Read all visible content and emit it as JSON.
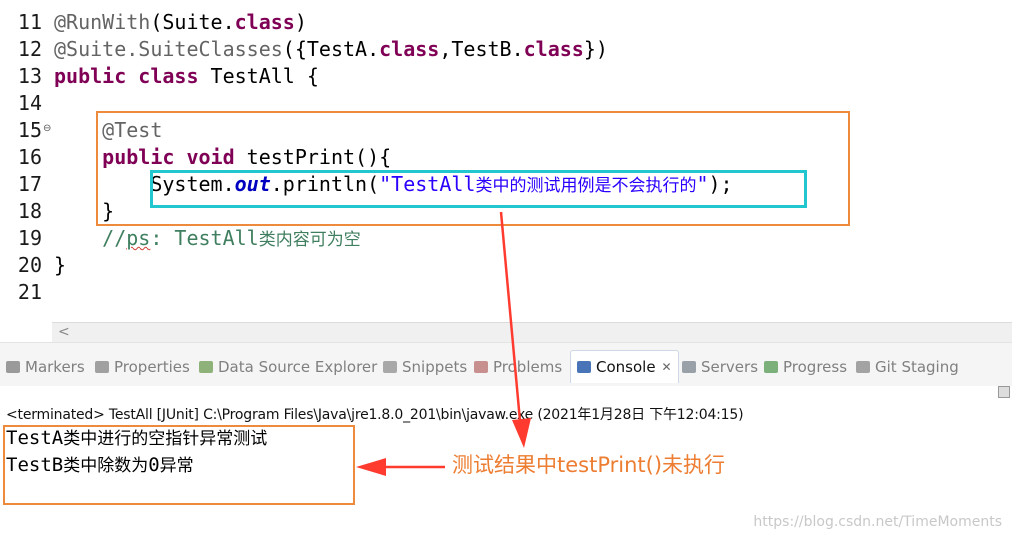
{
  "editor": {
    "lines": [
      {
        "num": "11",
        "parts": [
          [
            "ann",
            "@RunWith"
          ],
          [
            "",
            "(Suite."
          ],
          [
            "kw",
            "class"
          ],
          [
            "",
            ")"
          ]
        ]
      },
      {
        "num": "12",
        "parts": [
          [
            "ann",
            "@Suite.SuiteClasses"
          ],
          [
            "",
            "({TestA."
          ],
          [
            "kw",
            "class"
          ],
          [
            "",
            ",TestB."
          ],
          [
            "kw",
            "class"
          ],
          [
            "",
            "})"
          ]
        ]
      },
      {
        "num": "13",
        "parts": [
          [
            "kw",
            "public"
          ],
          [
            "",
            " "
          ],
          [
            "kw",
            "class"
          ],
          [
            "",
            " TestAll {"
          ]
        ]
      },
      {
        "num": "14",
        "parts": []
      },
      {
        "num": "15",
        "fold": true,
        "parts": [
          [
            "ann",
            "    @Test"
          ]
        ]
      },
      {
        "num": "16",
        "parts": [
          [
            "",
            "    "
          ],
          [
            "kw",
            "public"
          ],
          [
            "",
            " "
          ],
          [
            "kw",
            "void"
          ],
          [
            "",
            " testPrint(){"
          ]
        ]
      },
      {
        "num": "17",
        "parts": [
          [
            "",
            "        System."
          ],
          [
            "field",
            "out"
          ],
          [
            "",
            ".println("
          ],
          [
            "str",
            "\"TestAll"
          ],
          [
            "strcjk",
            "类中的测试用例是不会执行的"
          ],
          [
            "str",
            "\""
          ],
          [
            "",
            ");"
          ]
        ]
      },
      {
        "num": "18",
        "parts": [
          [
            "",
            "    }"
          ]
        ]
      },
      {
        "num": "19",
        "parts": [
          [
            "cmt",
            "    //"
          ],
          [
            "cmtsq",
            "ps"
          ],
          [
            "cmt",
            ": TestAll"
          ],
          [
            "cmtcjk",
            "类内容可为空"
          ]
        ]
      },
      {
        "num": "20",
        "parts": [
          [
            "",
            "}"
          ]
        ]
      },
      {
        "num": "21",
        "parts": []
      }
    ],
    "scroll_left_arrow": "<"
  },
  "tabs": [
    {
      "label": "Markers",
      "icon": "markers-icon",
      "color": "#9a9a9a"
    },
    {
      "label": "Properties",
      "icon": "properties-icon",
      "color": "#a0a0a0"
    },
    {
      "label": "Data Source Explorer",
      "icon": "data-source-icon",
      "color": "#8fb27a"
    },
    {
      "label": "Snippets",
      "icon": "snippets-icon",
      "color": "#a8a8a8"
    },
    {
      "label": "Problems",
      "icon": "problems-icon",
      "color": "#c88f8f"
    },
    {
      "label": "Console",
      "icon": "console-icon",
      "color": "#4a74b8",
      "active": true,
      "close": "✕"
    },
    {
      "label": "Servers",
      "icon": "servers-icon",
      "color": "#9aa0a8"
    },
    {
      "label": "Progress",
      "icon": "progress-icon",
      "color": "#7bb07b"
    },
    {
      "label": "Git Staging",
      "icon": "git-staging-icon",
      "color": "#a3a3a3"
    }
  ],
  "console": {
    "terminated": "<terminated> TestAll [JUnit] C:\\Program Files\\Java\\jre1.8.0_201\\bin\\javaw.exe (2021年1月28日 下午12:04:15)",
    "output": [
      {
        "mono": "TestA",
        "cjk": "类中进行的空指针异常测试"
      },
      {
        "mono": "TestB",
        "cjk": "类中除数为",
        "mono2": "0",
        "cjk2": "异常"
      }
    ]
  },
  "annotation": {
    "note": "测试结果中testPrint()未执行",
    "colors": {
      "orange": "#ed8a3c",
      "cyan": "#22c6cf",
      "arrow": "#ff3b30"
    }
  },
  "watermark": "https://blog.csdn.net/TimeMoments"
}
